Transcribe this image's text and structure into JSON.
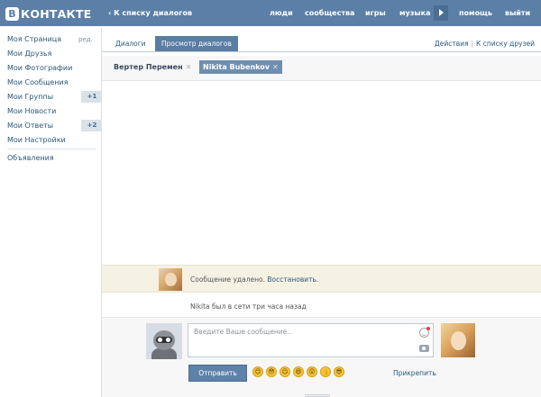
{
  "header": {
    "logo_letter": "В",
    "logo_text": "КОНТАКТЕ",
    "back_link": "‹ К списку диалогов",
    "nav": [
      "люди",
      "сообщества",
      "игры",
      "музыка",
      "помощь",
      "выйти"
    ]
  },
  "sidebar": {
    "items": [
      {
        "label": "Моя Страница",
        "extra": "ред."
      },
      {
        "label": "Мои Друзья"
      },
      {
        "label": "Мои Фотографии"
      },
      {
        "label": "Мои Сообщения"
      },
      {
        "label": "Мои Группы",
        "badge": "+1"
      },
      {
        "label": "Мои Новости"
      },
      {
        "label": "Мои Ответы",
        "badge": "+2"
      },
      {
        "label": "Мои Настройки"
      }
    ],
    "ads": "Объявления"
  },
  "tabs": {
    "items": [
      "Диалоги",
      "Просмотр диалогов"
    ],
    "active": "Просмотр диалогов",
    "right_actions": "Действия",
    "right_friends": "К списку друзей",
    "separator": "|"
  },
  "contacts": [
    {
      "name": "Вертер Перемен",
      "close": "✕",
      "active": false
    },
    {
      "name": "Nikita Bubenkov",
      "close": "✕",
      "active": true
    }
  ],
  "messages": {
    "deleted_text": "Сообщение удалено.",
    "restore_link": "Восстановить.",
    "status": "Nikita был в сети три часа назад"
  },
  "composer": {
    "placeholder": "Введите Ваше сообщение..",
    "send_label": "Отправить",
    "attach_label": "Прикрепить",
    "emoji": [
      "😊",
      "😳",
      "😉",
      "😄",
      "😲",
      "👍",
      "😎"
    ]
  },
  "colors": {
    "header_bg": "#5b7fa6",
    "accent": "#597da3",
    "link": "#2b587a",
    "notice_bg": "#f5f2e4"
  }
}
